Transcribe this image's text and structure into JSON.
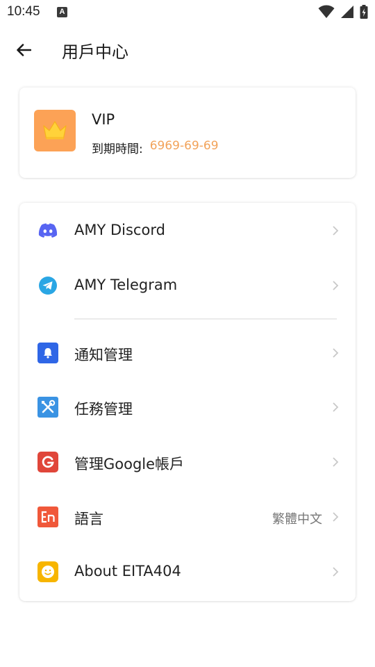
{
  "status_bar": {
    "time": "10:45",
    "notification_glyph": "A"
  },
  "app_bar": {
    "title": "用戶中心"
  },
  "vip_card": {
    "title": "VIP",
    "expire_label": "到期時間:",
    "expire_date": "6969-69-69",
    "badge_color": "#fca256",
    "date_color": "#f2a35a"
  },
  "menu": {
    "items": [
      {
        "icon": "discord-icon",
        "label": "AMY Discord",
        "value": "",
        "color": "#5865f2"
      },
      {
        "icon": "telegram-icon",
        "label": "AMY Telegram",
        "value": "",
        "color": "#2aa6e4"
      },
      {
        "icon": "bell-icon",
        "label": "通知管理",
        "value": "",
        "color": "#2f66e6"
      },
      {
        "icon": "tools-icon",
        "label": "任務管理",
        "value": "",
        "color": "#3a93e3"
      },
      {
        "icon": "google-icon",
        "label": "管理Google帳戶",
        "value": "",
        "color": "#e0463a"
      },
      {
        "icon": "language-icon",
        "label": "語言",
        "value": "繁體中文",
        "color": "#f0583a"
      },
      {
        "icon": "smile-icon",
        "label": "About EITA404",
        "value": "",
        "color": "#f7b500"
      }
    ]
  }
}
